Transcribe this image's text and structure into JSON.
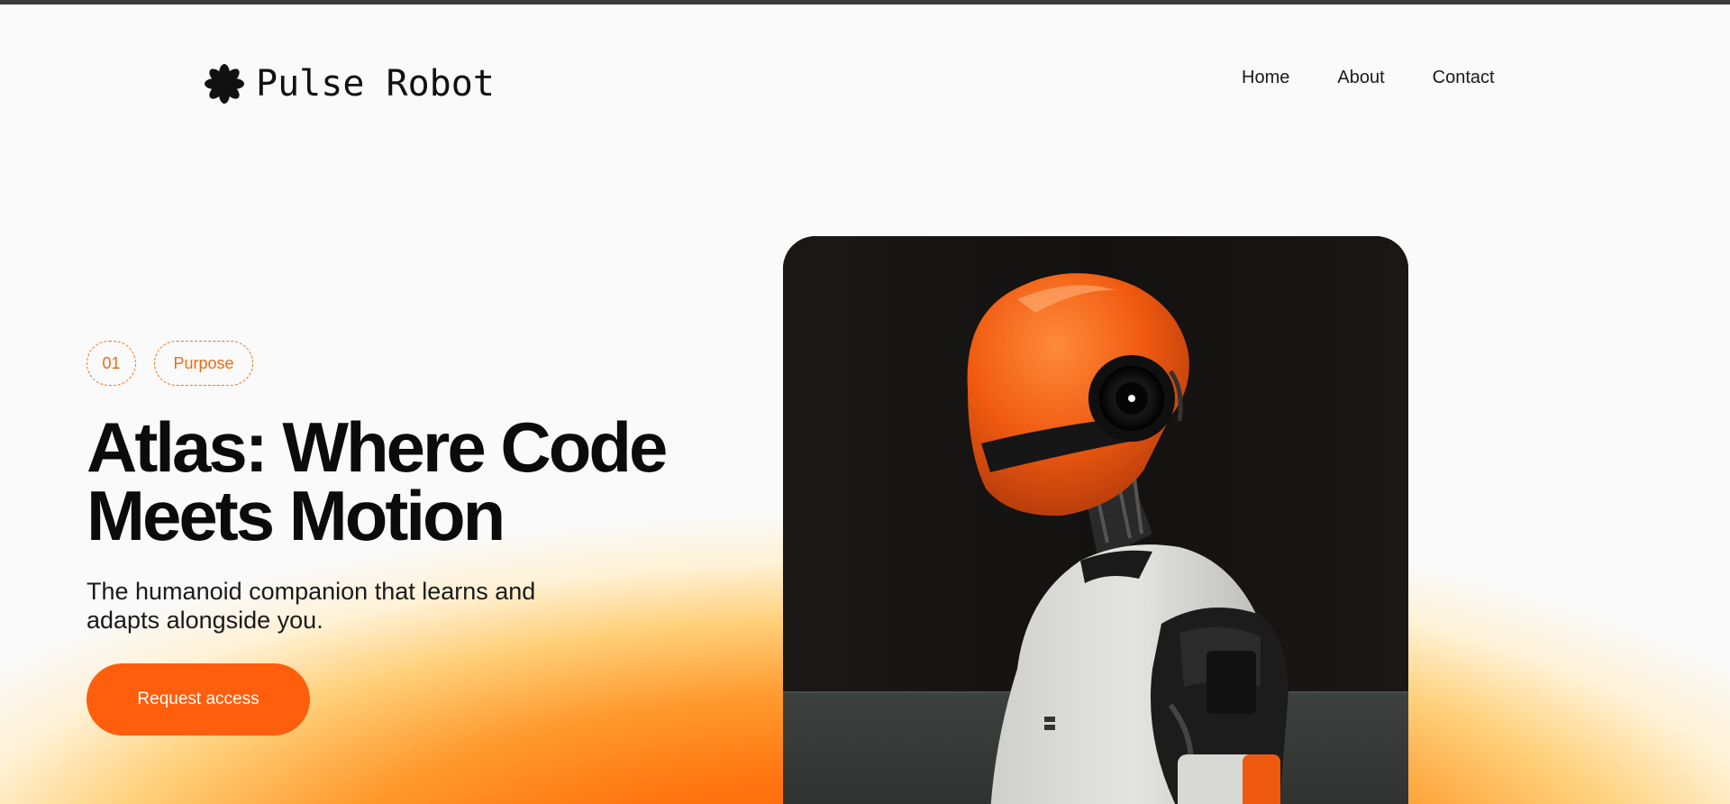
{
  "brand": {
    "name": "Pulse Robot",
    "icon": "asterisk-flower-icon"
  },
  "nav": {
    "items": [
      {
        "label": "Home"
      },
      {
        "label": "About"
      },
      {
        "label": "Contact"
      }
    ]
  },
  "hero": {
    "pill_number": "01",
    "pill_label": "Purpose",
    "title_line1": "Atlas: Where Code",
    "title_line2": "Meets Motion",
    "subtitle": "The humanoid companion that learns and adapts alongside you.",
    "cta_label": "Request access",
    "image": "humanoid-robot-orange-helmet"
  },
  "colors": {
    "accent": "#ff5e0c",
    "pill_outline": "#f0731a",
    "text_dark": "#0b0b0b",
    "top_bar": "#3a3a3a",
    "background": "#fafafa"
  }
}
